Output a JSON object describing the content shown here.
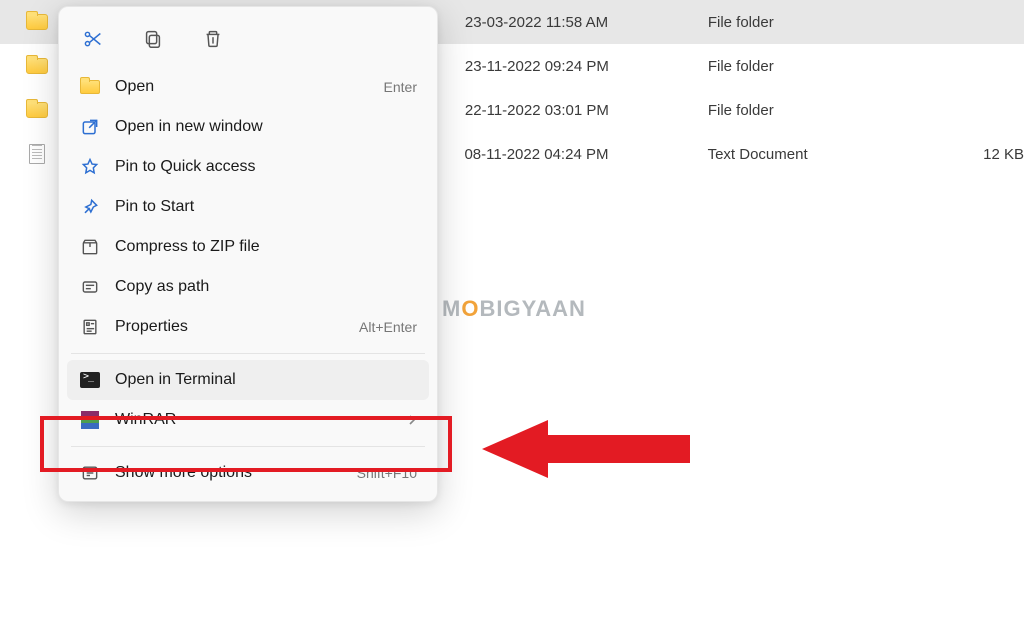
{
  "files": [
    {
      "date": "23-03-2022 11:58 AM",
      "type": "File folder",
      "size": ""
    },
    {
      "date": "23-11-2022 09:24 PM",
      "type": "File folder",
      "size": ""
    },
    {
      "date": "22-11-2022 03:01 PM",
      "type": "File folder",
      "size": ""
    },
    {
      "date": "08-11-2022 04:24 PM",
      "type": "Text Document",
      "size": "12 KB"
    }
  ],
  "context_menu": {
    "open": {
      "label": "Open",
      "shortcut": "Enter"
    },
    "new_window": {
      "label": "Open in new window"
    },
    "pin_quick": {
      "label": "Pin to Quick access"
    },
    "pin_start": {
      "label": "Pin to Start"
    },
    "compress": {
      "label": "Compress to ZIP file"
    },
    "copy_path": {
      "label": "Copy as path"
    },
    "properties": {
      "label": "Properties",
      "shortcut": "Alt+Enter"
    },
    "terminal": {
      "label": "Open in Terminal"
    },
    "winrar": {
      "label": "WinRAR"
    },
    "more": {
      "label": "Show more options",
      "shortcut": "Shift+F10"
    }
  },
  "watermark": {
    "m": "M",
    "o": "O",
    "rest": "BIGYAAN"
  }
}
